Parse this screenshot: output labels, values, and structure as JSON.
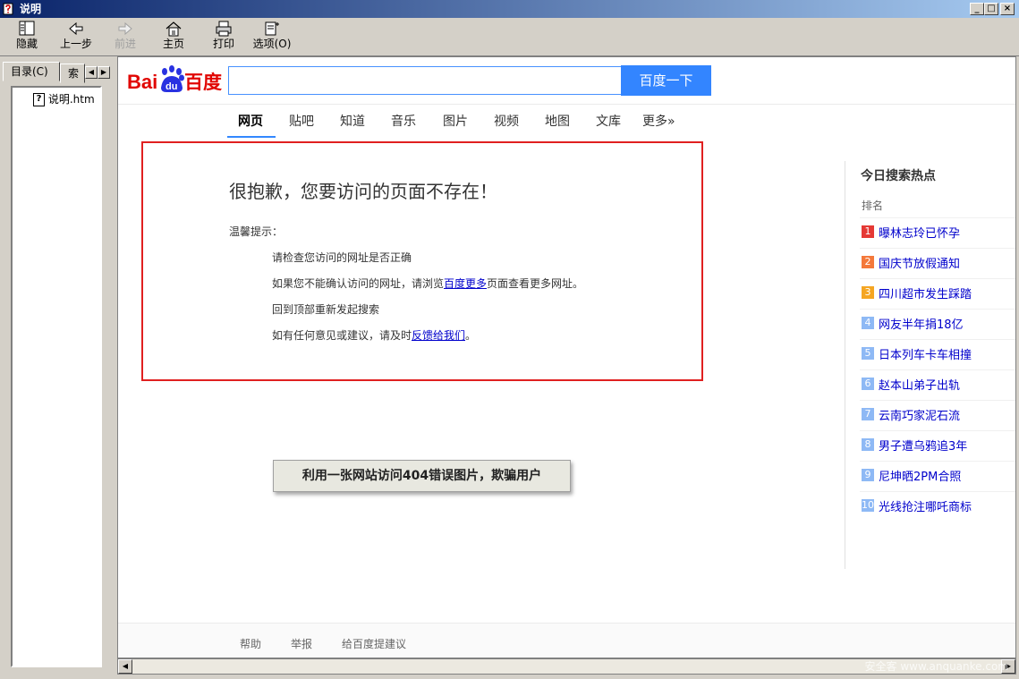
{
  "window": {
    "title": "说明",
    "controls": {
      "minimize": "_",
      "maximize": "□",
      "close": "×"
    }
  },
  "toolbar": {
    "hide_label": "隐藏",
    "back_label": "上一步",
    "forward_label": "前进",
    "home_label": "主页",
    "print_label": "打印",
    "options_label": "选项(O)"
  },
  "leftpane": {
    "tab_contents": "目录(C)",
    "tab_index": "索",
    "tree_item": "说明.htm"
  },
  "search": {
    "logo_bai": "Bai",
    "logo_du": "du",
    "logo_baidu": "百度",
    "placeholder": "",
    "button_label": "百度一下"
  },
  "nav": {
    "items": [
      "网页",
      "贴吧",
      "知道",
      "音乐",
      "图片",
      "视频",
      "地图",
      "文库",
      "更多»"
    ],
    "active": "网页"
  },
  "error": {
    "title": "很抱歉，您要访问的页面不存在！",
    "tips_label": "温馨提示：",
    "tip1": "请检查您访问的网址是否正确",
    "tip2_pre": "如果您不能确认访问的网址，请浏览",
    "tip2_link": "百度更多",
    "tip2_post": "页面查看更多网址。",
    "tip3": "回到顶部重新发起搜索",
    "tip4_pre": "如有任何意见或建议，请及时",
    "tip4_link": "反馈给我们",
    "tip4_post": "。"
  },
  "hot": {
    "title": "今日搜索热点",
    "rank_label": "排名",
    "items": [
      {
        "num": "1",
        "text": "曝林志玲已怀孕",
        "color": "#e53935"
      },
      {
        "num": "2",
        "text": "国庆节放假通知",
        "color": "#f4793b"
      },
      {
        "num": "3",
        "text": "四川超市发生踩踏",
        "color": "#f5a623"
      },
      {
        "num": "4",
        "text": "网友半年捐18亿",
        "color": "#8eb9f5"
      },
      {
        "num": "5",
        "text": "日本列车卡车相撞",
        "color": "#8eb9f5"
      },
      {
        "num": "6",
        "text": "赵本山弟子出轨",
        "color": "#8eb9f5"
      },
      {
        "num": "7",
        "text": "云南巧家泥石流",
        "color": "#8eb9f5"
      },
      {
        "num": "8",
        "text": "男子遭乌鸦追3年",
        "color": "#8eb9f5"
      },
      {
        "num": "9",
        "text": "尼坤晒2PM合照",
        "color": "#8eb9f5"
      },
      {
        "num": "10",
        "text": "光线抢注哪吒商标",
        "color": "#8eb9f5"
      }
    ]
  },
  "callout": "利用一张网站访问404错误图片，欺骗用户",
  "footer": {
    "help": "帮助",
    "report": "举报",
    "suggest": "给百度提建议"
  },
  "watermark": "安全客 www.anquanke.com"
}
